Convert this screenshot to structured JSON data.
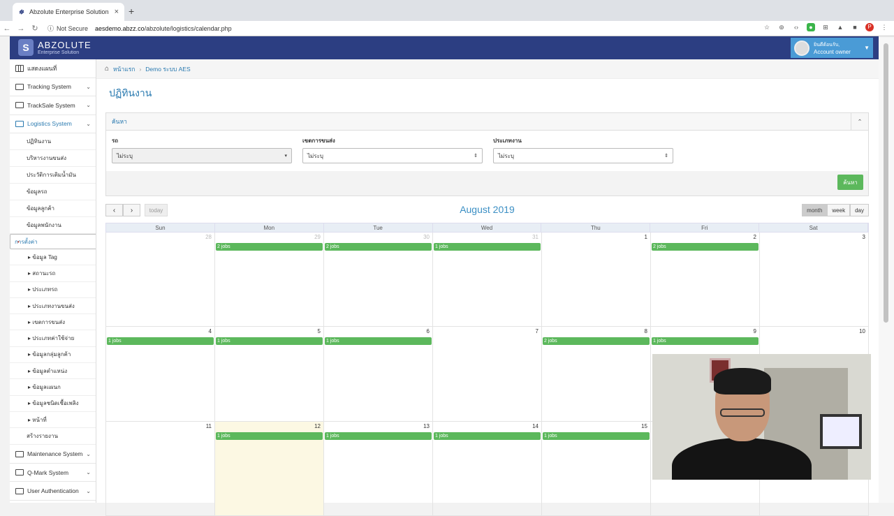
{
  "browser": {
    "tab_title": "Abzolute Enterprise Solution",
    "tab_close": "×",
    "new_tab": "+",
    "not_secure": "Not Secure",
    "url_host": "aesdemo.abzz.co",
    "url_path": "/abzolute/logistics/calendar.php"
  },
  "header": {
    "brand": "ABZOLUTE",
    "tagline": "Enterprise Solution",
    "user_name": "ยินดีต้อนรับ,",
    "user_role": "Account owner"
  },
  "sidebar": {
    "items": [
      {
        "label": "แสดงแผนที่"
      },
      {
        "label": "Tracking System"
      },
      {
        "label": "TrackSale System"
      },
      {
        "label": "Logistics System"
      }
    ],
    "logistics_subs": [
      "ปฏิทินงาน",
      "บริหารงานขนส่ง",
      "ประวัติการเติมน้ำมัน",
      "ข้อมูลรถ",
      "ข้อมูลลูกค้า",
      "ข้อมูลพนักงาน",
      "การตั้งค่า"
    ],
    "settings_subs": [
      "ข้อมูล Tag",
      "สถานะรถ",
      "ประเภทรถ",
      "ประเภทงานขนส่ง",
      "เขตการขนส่ง",
      "ประเภทค่าใช้จ่าย",
      "ข้อมูลกลุ่มลูกค้า",
      "ข้อมูลตำแหน่ง",
      "ข้อมูลแผนก",
      "ข้อมูลชนิดเชื้อเพลิง",
      "หน้าที่"
    ],
    "report": "สร้างรายงาน",
    "bottom_items": [
      {
        "label": "Maintenance System"
      },
      {
        "label": "Q-Mark System"
      },
      {
        "label": "User Authentication"
      }
    ]
  },
  "breadcrumb": {
    "home": "หน้าแรก",
    "current": "Demo ระบบ AES"
  },
  "page": {
    "title": "ปฏิทินงาน"
  },
  "search_panel": {
    "title": "ค้นหา",
    "vehicle_label": "รถ",
    "vehicle_value": "ไม่ระบุ",
    "zone_label": "เขตการขนส่ง",
    "zone_value": "ไม่ระบุ",
    "jobtype_label": "ประเภทงาน",
    "jobtype_value": "ไม่ระบุ",
    "search_button": "ค้นหา"
  },
  "calendar": {
    "title": "August 2019",
    "today_button": "today",
    "views": [
      "month",
      "week",
      "day"
    ],
    "active_view": "month",
    "dow": [
      "Sun",
      "Mon",
      "Tue",
      "Wed",
      "Thu",
      "Fri",
      "Sat"
    ],
    "weeks": [
      [
        {
          "num": "28",
          "other": true,
          "ev": ""
        },
        {
          "num": "29",
          "other": true,
          "ev": "2 jobs"
        },
        {
          "num": "30",
          "other": true,
          "ev": "2 jobs"
        },
        {
          "num": "31",
          "other": true,
          "ev": "1 jobs"
        },
        {
          "num": "1",
          "other": false,
          "ev": ""
        },
        {
          "num": "2",
          "other": false,
          "ev": "2 jobs"
        },
        {
          "num": "3",
          "other": false,
          "ev": ""
        }
      ],
      [
        {
          "num": "4",
          "other": false,
          "ev": "1 jobs"
        },
        {
          "num": "5",
          "other": false,
          "ev": "1 jobs"
        },
        {
          "num": "6",
          "other": false,
          "ev": "1 jobs"
        },
        {
          "num": "7",
          "other": false,
          "ev": ""
        },
        {
          "num": "8",
          "other": false,
          "ev": "2 jobs"
        },
        {
          "num": "9",
          "other": false,
          "ev": "1 jobs"
        },
        {
          "num": "10",
          "other": false,
          "ev": ""
        }
      ],
      [
        {
          "num": "11",
          "other": false,
          "ev": ""
        },
        {
          "num": "12",
          "other": false,
          "ev": "1 jobs",
          "today": true
        },
        {
          "num": "13",
          "other": false,
          "ev": "1 jobs"
        },
        {
          "num": "14",
          "other": false,
          "ev": "1 jobs"
        },
        {
          "num": "15",
          "other": false,
          "ev": "1 jobs"
        },
        {
          "num": "",
          "other": false,
          "ev": ""
        },
        {
          "num": "",
          "other": false,
          "ev": ""
        }
      ]
    ]
  },
  "colors": {
    "header_bg": "#2c3e82",
    "accent": "#2a7ab0",
    "event_green": "#5cb85c",
    "today_bg": "#fcf8e3"
  }
}
